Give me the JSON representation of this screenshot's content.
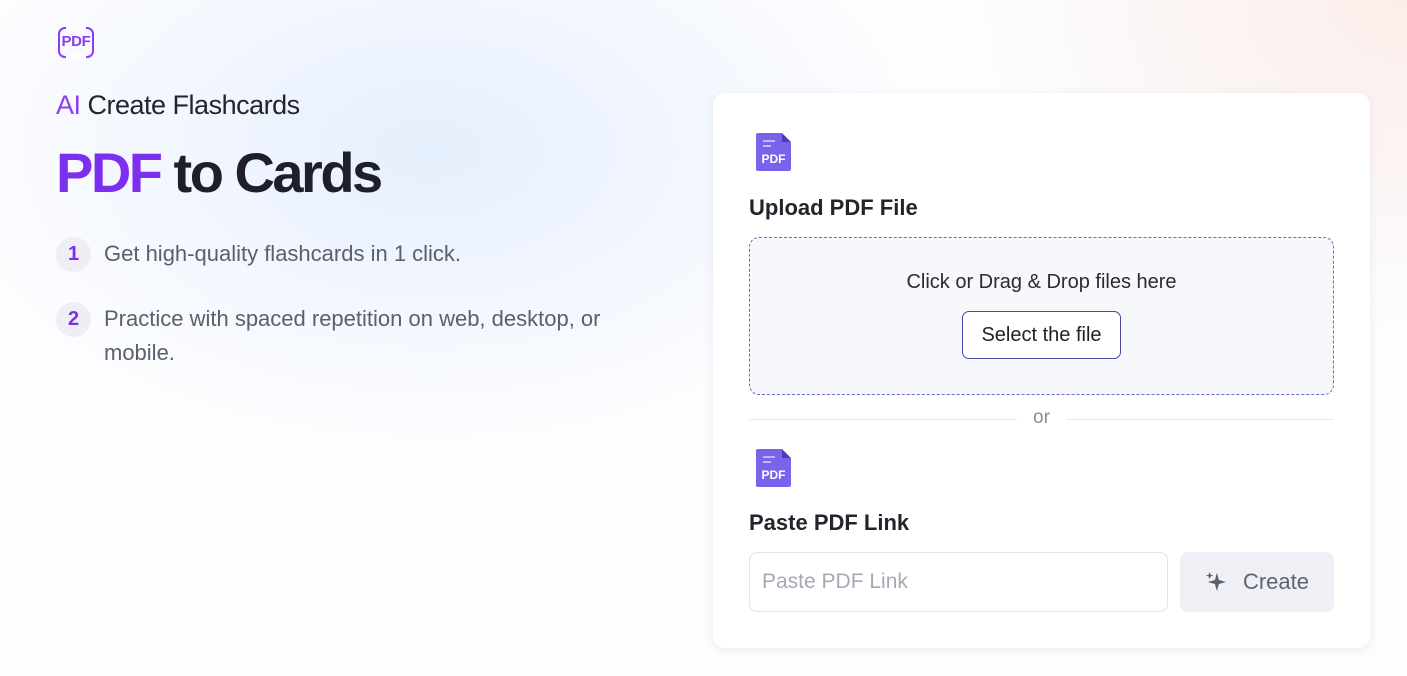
{
  "logo": {
    "text": "PDF"
  },
  "hero": {
    "subtitle_accent": "AI",
    "subtitle_rest": " Create Flashcards",
    "headline_accent": "PDF",
    "headline_rest": " to Cards"
  },
  "steps": [
    {
      "num": "1",
      "text": "Get high-quality flashcards in 1 click."
    },
    {
      "num": "2",
      "text": "Practice with spaced repetition on web, desktop, or mobile."
    }
  ],
  "upload": {
    "icon_label": "PDF",
    "title": "Upload PDF File",
    "drop_text": "Click or Drag & Drop files here",
    "select_label": "Select the file"
  },
  "divider": {
    "text": "or"
  },
  "link": {
    "icon_label": "PDF",
    "title": "Paste PDF Link",
    "placeholder": "Paste PDF Link",
    "value": "",
    "create_label": "Create"
  },
  "colors": {
    "accent_purple": "#7d2ff0",
    "pdf_icon": "#7b62ea",
    "dropzone_border": "#6c6cc8"
  },
  "icons": [
    "pdf-logo-icon",
    "pdf-file-icon",
    "sparkle-icon"
  ]
}
